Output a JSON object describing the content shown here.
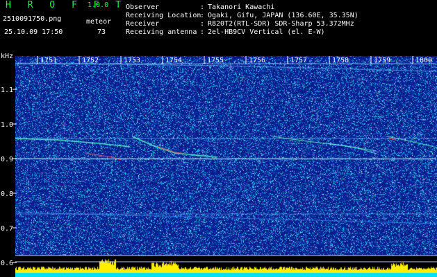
{
  "app": {
    "title": "H R O F F T",
    "version": "1.0.0"
  },
  "file": {
    "name": "2510091750.png",
    "datetime": "25.10.09 17:50"
  },
  "meteor": {
    "label": "meteor",
    "count": "73"
  },
  "info": [
    {
      "label": "Observer",
      "sep": ":",
      "value": "Takanori Kawachi"
    },
    {
      "label": "Receiving Location",
      "sep": ":",
      "value": "Ogaki, Gifu, JAPAN (136.60E, 35.35N)"
    },
    {
      "label": "Receiver",
      "sep": ":",
      "value": "R820T2(RTL-SDR) SDR-Sharp 53.372MHz"
    },
    {
      "label": "Receiving antenna",
      "sep": ":",
      "value": "2el-HB9CV Vertical (el. E-W)"
    }
  ],
  "axis": {
    "unit": "kHz",
    "y_ticks": [
      "1.1",
      "1.0",
      "0.9",
      "0.8",
      "0.7",
      "0.6"
    ],
    "x_ticks": [
      "1751",
      "1752",
      "1753",
      "1754",
      "1755",
      "1756",
      "1757",
      "1758",
      "1759",
      "1800"
    ]
  },
  "colors": {
    "title": "#00ff40",
    "text": "#ffffff",
    "background": "#000000",
    "noise_low": "#0a1a8a",
    "noise_high": "#3a8cff",
    "trail": "#60ffd0",
    "bottom_bar": "#00e0ff",
    "peak": "#ffee00"
  }
}
